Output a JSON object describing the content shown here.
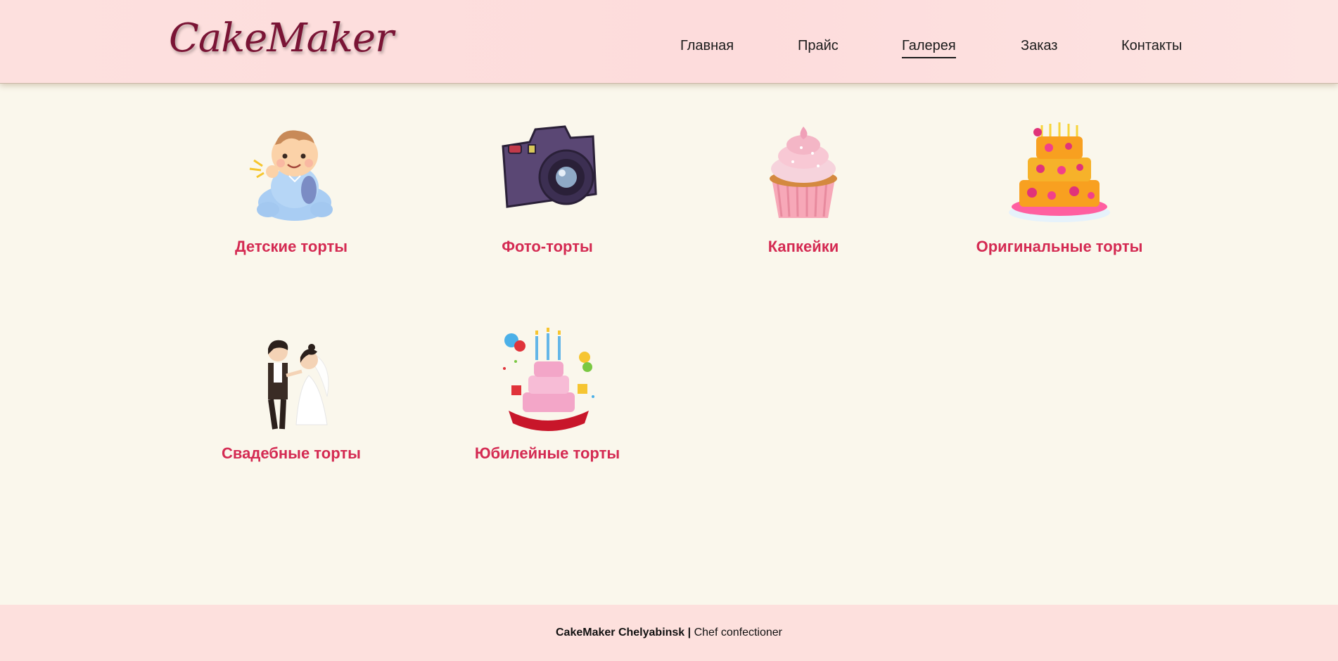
{
  "header": {
    "logo": "CakeMaker",
    "nav": [
      {
        "label": "Главная",
        "active": false
      },
      {
        "label": "Прайс",
        "active": false
      },
      {
        "label": "Галерея",
        "active": true
      },
      {
        "label": "Заказ",
        "active": false
      },
      {
        "label": "Контакты",
        "active": false
      }
    ]
  },
  "gallery": {
    "items": [
      {
        "label": "Детские торты",
        "icon": "baby-icon"
      },
      {
        "label": "Фото-торты",
        "icon": "camera-icon"
      },
      {
        "label": "Капкейки",
        "icon": "cupcake-icon"
      },
      {
        "label": "Оригинальные торты",
        "icon": "tiered-cake-icon"
      },
      {
        "label": "Свадебные торты",
        "icon": "wedding-couple-icon"
      },
      {
        "label": "Юбилейные торты",
        "icon": "anniversary-cake-icon"
      }
    ]
  },
  "footer": {
    "brand": "CakeMaker Chelyabinsk",
    "separator": "|",
    "role": "Chef confectioner"
  }
}
